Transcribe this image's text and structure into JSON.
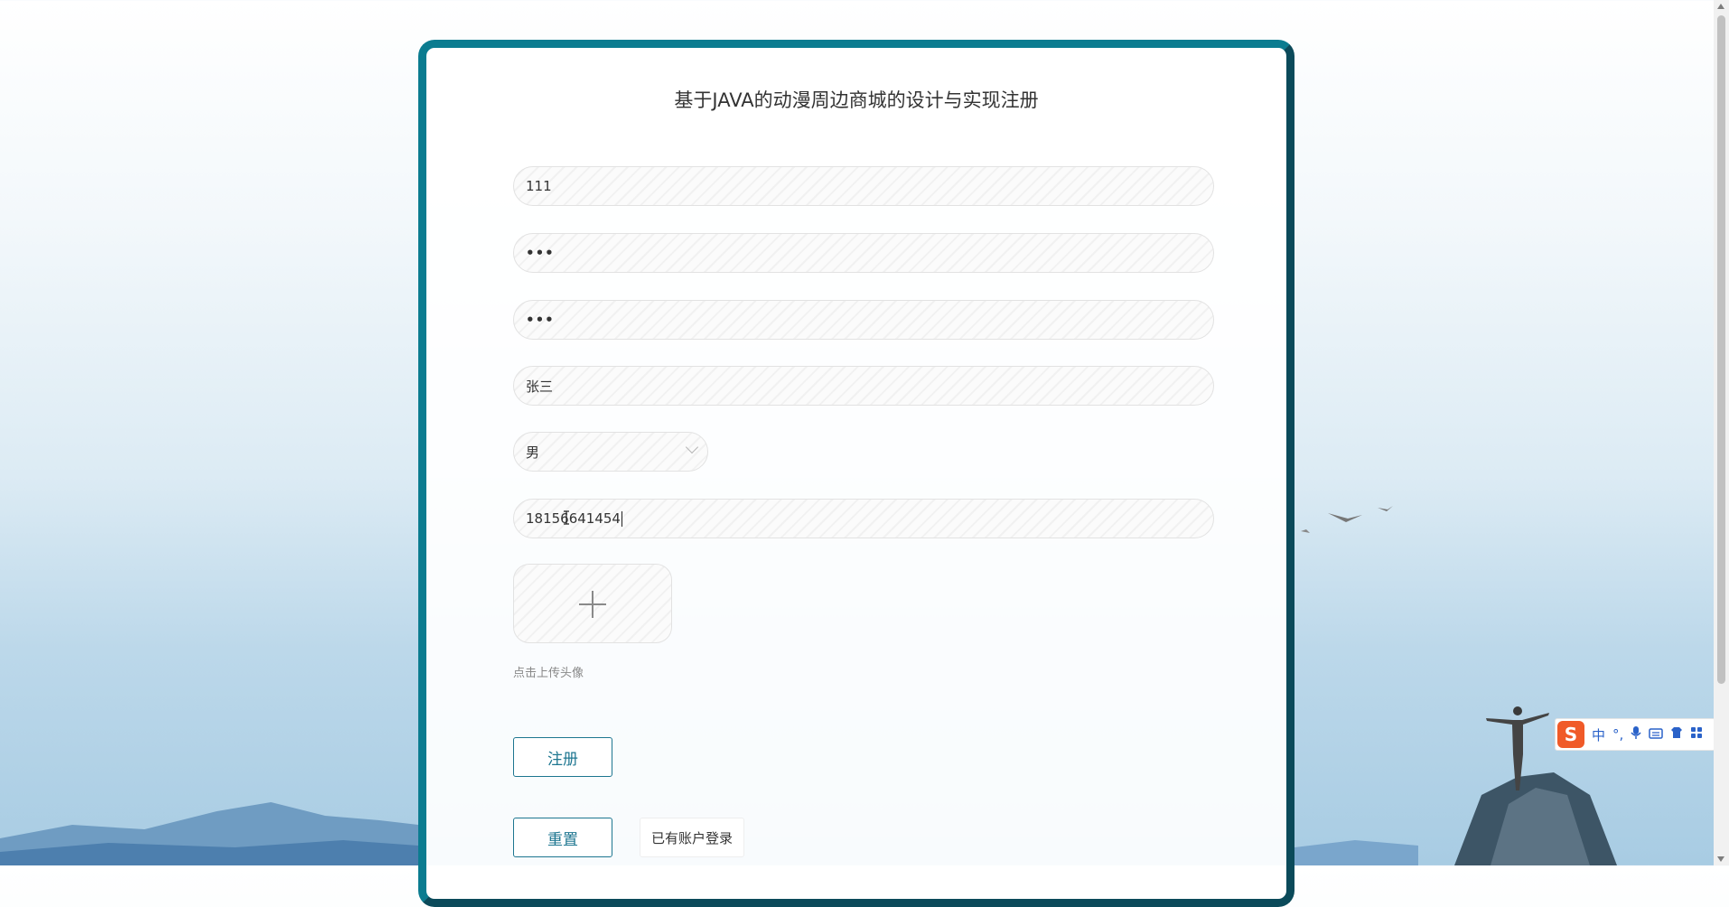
{
  "page": {
    "title": "基于JAVA的动漫周边商城的设计与实现注册"
  },
  "form": {
    "username_value": "111",
    "password_value": "•••",
    "confirm_password_value": "•••",
    "name_value": "张三",
    "gender_selected": "男",
    "phone_value": "18156641454",
    "upload_hint": "点击上传头像"
  },
  "buttons": {
    "register_label": "注册",
    "reset_label": "重置",
    "login_link_label": "已有账户登录"
  },
  "ime": {
    "logo": "S",
    "mode": "中",
    "punct": "°,",
    "icons": [
      "microphone-icon",
      "keyboard-icon",
      "skin-icon",
      "toolbox-icon"
    ]
  },
  "colors": {
    "accent": "#1d7690",
    "card_border": "#0b7c90",
    "ime_logo": "#f05a28"
  }
}
